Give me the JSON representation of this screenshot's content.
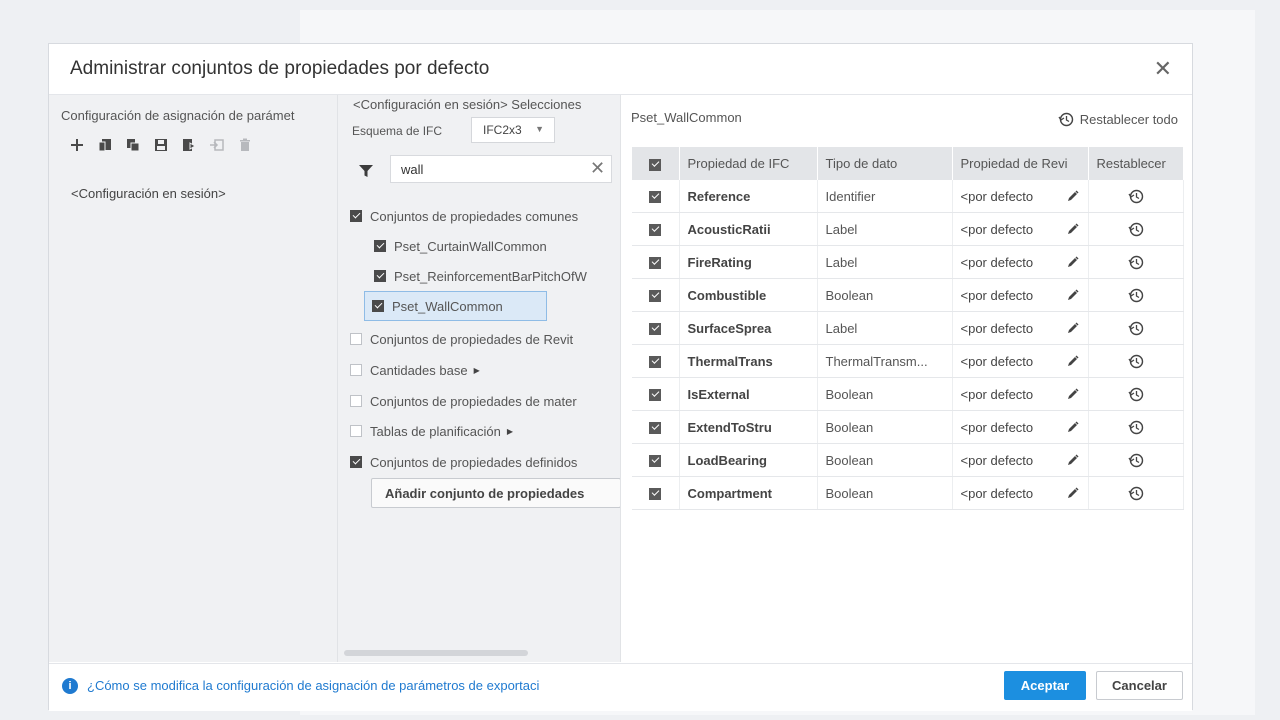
{
  "dialog": {
    "title": "Administrar conjuntos de propiedades por defecto",
    "close_icon": "close-icon"
  },
  "left_panel": {
    "title": "Configuración de asignación de parámet",
    "toolbar_icons": [
      "add-icon",
      "new-from-icon",
      "duplicate-icon",
      "save-icon",
      "import-icon",
      "export-icon",
      "delete-icon"
    ],
    "config_item": "<Configuración en sesión>"
  },
  "middle_panel": {
    "title": "<Configuración en sesión> Selecciones",
    "schema_label": "Esquema de IFC",
    "schema_value": "IFC2x3",
    "filter_value": "wall",
    "tree": [
      {
        "label": "Conjuntos de propiedades comunes",
        "checked": true
      },
      {
        "label": "Pset_CurtainWallCommon",
        "checked": true
      },
      {
        "label": "Pset_ReinforcementBarPitchOfW",
        "checked": true
      },
      {
        "label": "Pset_WallCommon",
        "checked": true
      },
      {
        "label": "Conjuntos de propiedades de Revit",
        "checked": false
      },
      {
        "label": "Cantidades base",
        "checked": false
      },
      {
        "label": "Conjuntos de propiedades de mater",
        "checked": false
      },
      {
        "label": "Tablas de planificación",
        "checked": false
      },
      {
        "label": "Conjuntos de propiedades definidos",
        "checked": true
      }
    ],
    "add_button": "Añadir conjunto de propiedades"
  },
  "right_panel": {
    "pset_name": "Pset_WallCommon",
    "reset_all": "Restablecer todo",
    "columns": [
      "Propiedad de IFC",
      "Tipo de dato",
      "Propiedad de Revi",
      "Restablecer"
    ],
    "rows": [
      {
        "prop": "Reference",
        "type": "Identifier",
        "map": "<por defecto"
      },
      {
        "prop": "AcousticRatii",
        "type": "Label",
        "map": "<por defecto"
      },
      {
        "prop": "FireRating",
        "type": "Label",
        "map": "<por defecto"
      },
      {
        "prop": "Combustible",
        "type": "Boolean",
        "map": "<por defecto"
      },
      {
        "prop": "SurfaceSprea",
        "type": "Label",
        "map": "<por defecto"
      },
      {
        "prop": "ThermalTrans",
        "type": "ThermalTransm...",
        "map": "<por defecto"
      },
      {
        "prop": "IsExternal",
        "type": "Boolean",
        "map": "<por defecto"
      },
      {
        "prop": "ExtendToStru",
        "type": "Boolean",
        "map": "<por defecto"
      },
      {
        "prop": "LoadBearing",
        "type": "Boolean",
        "map": "<por defecto"
      },
      {
        "prop": "Compartment",
        "type": "Boolean",
        "map": "<por defecto"
      }
    ]
  },
  "footer": {
    "help_link": "¿Cómo se modifica la configuración de asignación de parámetros de exportaci",
    "ok": "Aceptar",
    "cancel": "Cancelar"
  },
  "colors": {
    "accent": "#1c8fe0",
    "link": "#1f7ad0",
    "selected_bg": "#dbe9f7"
  }
}
